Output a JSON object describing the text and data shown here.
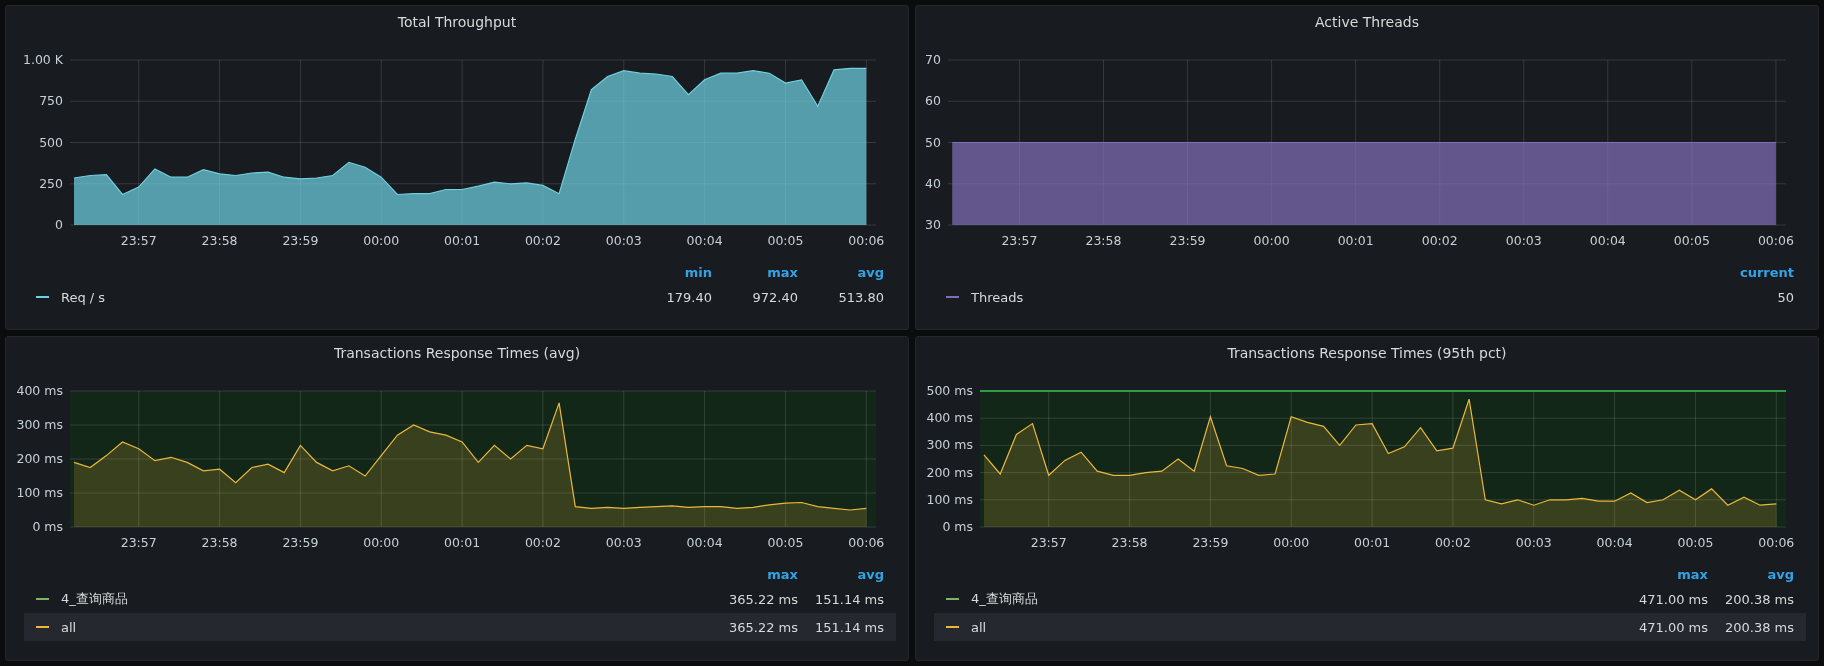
{
  "panels": [
    {
      "title": "Total Throughput",
      "chart_data": {
        "type": "area",
        "grid": true,
        "ylim": [
          0,
          1000
        ],
        "categories": [
          null,
          null,
          null,
          null,
          "23:57",
          null,
          null,
          null,
          null,
          "23:58",
          null,
          null,
          null,
          null,
          "23:59",
          null,
          null,
          null,
          null,
          "00:00",
          null,
          null,
          null,
          null,
          "00:01",
          null,
          null,
          null,
          null,
          "00:02",
          null,
          null,
          null,
          null,
          "00:03",
          null,
          null,
          null,
          null,
          "00:04",
          null,
          null,
          null,
          null,
          "00:05",
          null,
          null,
          null,
          null,
          "00:06"
        ],
        "yticks": [
          {
            "value": 0,
            "label": "0"
          },
          {
            "value": 250,
            "label": "250"
          },
          {
            "value": 500,
            "label": "500"
          },
          {
            "value": 750,
            "label": "750"
          },
          {
            "value": 1000,
            "label": "1.00 K"
          }
        ],
        "series": [
          {
            "name": "Req / s",
            "color": "#6ed0e0",
            "values": [
              285,
              300,
              305,
              185,
              230,
              340,
              290,
              290,
              335,
              310,
              300,
              315,
              320,
              290,
              280,
              285,
              300,
              380,
              350,
              290,
              185,
              190,
              190,
              215,
              215,
              235,
              260,
              250,
              255,
              240,
              190,
              520,
              820,
              900,
              935,
              920,
              915,
              900,
              790,
              880,
              920,
              920,
              935,
              920,
              860,
              880,
              720,
              940,
              950,
              950
            ]
          }
        ]
      },
      "legend": {
        "columns": [
          "min",
          "max",
          "avg"
        ],
        "rows": [
          {
            "highlighted": false,
            "values": [
              "179.40",
              "972.40",
              "513.80"
            ]
          }
        ]
      }
    },
    {
      "title": "Active Threads",
      "chart_data": {
        "type": "area",
        "grid": true,
        "ylim": [
          30,
          70
        ],
        "categories": [
          null,
          null,
          null,
          null,
          "23:57",
          null,
          null,
          null,
          null,
          "23:58",
          null,
          null,
          null,
          null,
          "23:59",
          null,
          null,
          null,
          null,
          "00:00",
          null,
          null,
          null,
          null,
          "00:01",
          null,
          null,
          null,
          null,
          "00:02",
          null,
          null,
          null,
          null,
          "00:03",
          null,
          null,
          null,
          null,
          "00:04",
          null,
          null,
          null,
          null,
          "00:05",
          null,
          null,
          null,
          null,
          "00:06"
        ],
        "yticks": [
          {
            "value": 30,
            "label": "30"
          },
          {
            "value": 40,
            "label": "40"
          },
          {
            "value": 50,
            "label": "50"
          },
          {
            "value": 60,
            "label": "60"
          },
          {
            "value": 70,
            "label": "70"
          }
        ],
        "series": [
          {
            "name": "Threads",
            "color": "#806eb7",
            "values": [
              50,
              50,
              50,
              50,
              50,
              50,
              50,
              50,
              50,
              50,
              50,
              50,
              50,
              50,
              50,
              50,
              50,
              50,
              50,
              50,
              50,
              50,
              50,
              50,
              50,
              50,
              50,
              50,
              50,
              50,
              50,
              50,
              50,
              50,
              50,
              50,
              50,
              50,
              50,
              50,
              50,
              50,
              50,
              50,
              50,
              50,
              50,
              50,
              50,
              50
            ]
          }
        ]
      },
      "legend": {
        "columns": [
          "current"
        ],
        "rows": [
          {
            "highlighted": false,
            "values": [
              "50"
            ]
          }
        ]
      }
    },
    {
      "title": "Transactions Response Times (avg)",
      "threshold_fill": true,
      "chart_data": {
        "type": "area",
        "grid": true,
        "ylim": [
          0,
          400
        ],
        "categories": [
          null,
          null,
          null,
          null,
          "23:57",
          null,
          null,
          null,
          null,
          "23:58",
          null,
          null,
          null,
          null,
          "23:59",
          null,
          null,
          null,
          null,
          "00:00",
          null,
          null,
          null,
          null,
          "00:01",
          null,
          null,
          null,
          null,
          "00:02",
          null,
          null,
          null,
          null,
          "00:03",
          null,
          null,
          null,
          null,
          "00:04",
          null,
          null,
          null,
          null,
          "00:05",
          null,
          null,
          null,
          null,
          "00:06"
        ],
        "yticks": [
          {
            "value": 0,
            "label": "0 ms"
          },
          {
            "value": 100,
            "label": "100 ms"
          },
          {
            "value": 200,
            "label": "200 ms"
          },
          {
            "value": 300,
            "label": "300 ms"
          },
          {
            "value": 400,
            "label": "400 ms"
          }
        ],
        "series": [
          {
            "name": "all",
            "color": "#eab839",
            "values": [
              190,
              175,
              210,
              250,
              230,
              195,
              205,
              190,
              165,
              170,
              130,
              175,
              185,
              160,
              240,
              190,
              165,
              180,
              150,
              210,
              270,
              300,
              280,
              270,
              250,
              190,
              240,
              200,
              240,
              230,
              365,
              60,
              55,
              58,
              55,
              58,
              60,
              62,
              58,
              60,
              60,
              55,
              58,
              65,
              70,
              72,
              60,
              55,
              50,
              55
            ]
          }
        ]
      },
      "legend": {
        "columns": [
          "max",
          "avg"
        ],
        "rows": [
          {
            "name": "4_查询商品",
            "color": "#7eb26d",
            "highlighted": false,
            "values": [
              "365.22 ms",
              "151.14 ms"
            ]
          },
          {
            "highlighted": true,
            "values": [
              "365.22 ms",
              "151.14 ms"
            ]
          }
        ]
      }
    },
    {
      "title": "Transactions Response Times (95th pct)",
      "threshold_fill": true,
      "threshold_line": true,
      "chart_data": {
        "type": "area",
        "grid": true,
        "ylim": [
          0,
          500
        ],
        "categories": [
          null,
          null,
          null,
          null,
          "23:57",
          null,
          null,
          null,
          null,
          "23:58",
          null,
          null,
          null,
          null,
          "23:59",
          null,
          null,
          null,
          null,
          "00:00",
          null,
          null,
          null,
          null,
          "00:01",
          null,
          null,
          null,
          null,
          "00:02",
          null,
          null,
          null,
          null,
          "00:03",
          null,
          null,
          null,
          null,
          "00:04",
          null,
          null,
          null,
          null,
          "00:05",
          null,
          null,
          null,
          null,
          "00:06"
        ],
        "yticks": [
          {
            "value": 0,
            "label": "0 ms"
          },
          {
            "value": 100,
            "label": "100 ms"
          },
          {
            "value": 200,
            "label": "200 ms"
          },
          {
            "value": 300,
            "label": "300 ms"
          },
          {
            "value": 400,
            "label": "400 ms"
          },
          {
            "value": 500,
            "label": "500 ms"
          }
        ],
        "series": [
          {
            "name": "all",
            "color": "#eab839",
            "values": [
              265,
              195,
              340,
              380,
              190,
              245,
              275,
              205,
              190,
              190,
              200,
              205,
              250,
              205,
              405,
              225,
              215,
              190,
              195,
              405,
              385,
              370,
              300,
              375,
              380,
              270,
              295,
              365,
              280,
              290,
              470,
              100,
              85,
              100,
              80,
              100,
              100,
              105,
              95,
              95,
              125,
              90,
              100,
              135,
              100,
              140,
              80,
              110,
              80,
              85
            ]
          }
        ]
      },
      "legend": {
        "columns": [
          "max",
          "avg"
        ],
        "rows": [
          {
            "name": "4_查询商品",
            "color": "#7eb26d",
            "highlighted": false,
            "values": [
              "471.00 ms",
              "200.38 ms"
            ]
          },
          {
            "highlighted": true,
            "values": [
              "471.00 ms",
              "200.38 ms"
            ]
          }
        ]
      }
    }
  ]
}
